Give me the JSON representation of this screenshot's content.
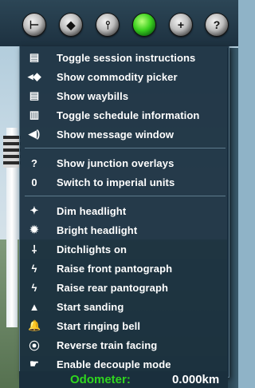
{
  "toolbar": {
    "buttons": [
      {
        "name": "driving-button",
        "glyph": "⊢"
      },
      {
        "name": "eraser-button",
        "glyph": "◆"
      },
      {
        "name": "junction-button",
        "glyph": "⫯"
      },
      {
        "name": "status-button",
        "glyph": ""
      },
      {
        "name": "add-button",
        "glyph": "+"
      },
      {
        "name": "help-button",
        "glyph": "?"
      }
    ],
    "status_color": "#3bd11f"
  },
  "menu": {
    "items": [
      {
        "label": "Toggle session instructions",
        "icon": "document-icon",
        "glyph": "▤"
      },
      {
        "label": "Show commodity picker",
        "icon": "diamond-arrows-icon",
        "glyph": "◂◆"
      },
      {
        "label": "Show waybills",
        "icon": "waybill-icon",
        "glyph": "▤"
      },
      {
        "label": "Toggle schedule information",
        "icon": "schedule-icon",
        "glyph": "▥"
      },
      {
        "label": "Show message window",
        "icon": "speaker-icon",
        "glyph": "◀)"
      },
      {
        "label": "Show junction overlays",
        "icon": "question-icon",
        "glyph": "?"
      },
      {
        "label": "Switch to imperial units",
        "icon": "units-icon",
        "glyph": "0"
      },
      {
        "label": "Dim headlight",
        "icon": "dim-headlight-icon",
        "glyph": "✦"
      },
      {
        "label": "Bright headlight",
        "icon": "bright-headlight-icon",
        "glyph": "✹"
      },
      {
        "label": "Ditchlights on",
        "icon": "ditchlight-icon",
        "glyph": "⸸"
      },
      {
        "label": "Raise front pantograph",
        "icon": "pantograph-front-icon",
        "glyph": "ϟ"
      },
      {
        "label": "Raise rear pantograph",
        "icon": "pantograph-rear-icon",
        "glyph": "ϟ"
      },
      {
        "label": "Start sanding",
        "icon": "sand-icon",
        "glyph": "▲"
      },
      {
        "label": "Start ringing bell",
        "icon": "bell-icon",
        "glyph": "🔔"
      },
      {
        "label": "Reverse train facing",
        "icon": "reverse-icon",
        "glyph": "⦿"
      },
      {
        "label": "Enable decouple mode",
        "icon": "decouple-icon",
        "glyph": "☛"
      }
    ]
  },
  "odometer": {
    "label": "Odometer:",
    "value": "0.000km"
  },
  "colors": {
    "menu_bg": "#182d3d",
    "text": "#ffffff",
    "odometer_label": "#2fd61e"
  }
}
